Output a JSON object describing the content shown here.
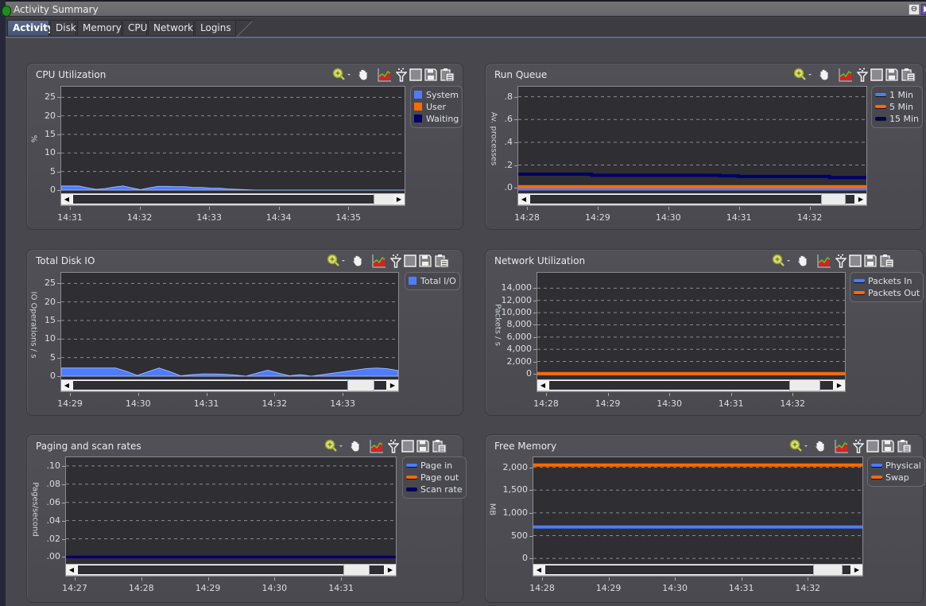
{
  "window": {
    "title": "Activity Summary",
    "controls": [
      "zoom-out",
      "restore"
    ]
  },
  "tabs": [
    {
      "label": "Activity",
      "active": true
    },
    {
      "label": "Disk",
      "active": false
    },
    {
      "label": "Memory",
      "active": false
    },
    {
      "label": "CPU",
      "active": false
    },
    {
      "label": "Network",
      "active": false
    },
    {
      "label": "Logins",
      "active": false
    }
  ],
  "toolbar_icons": [
    "zoom-in-icon",
    "pan-hand-icon",
    "chart-type-icon",
    "filter-icon",
    "maximize-icon",
    "save-icon",
    "clipboard-icon"
  ],
  "colors": {
    "blue": "#4d7cfe",
    "orange": "#ff6a00",
    "navy": "#000066",
    "plot_bg": "#2e2e33"
  },
  "chart_data": [
    {
      "id": "cpu",
      "title": "CPU Utilization",
      "type": "area",
      "ylabel": "%",
      "yticks": [
        "0",
        "5",
        "10",
        "15",
        "20",
        "25"
      ],
      "ylim": [
        0,
        27
      ],
      "xticks": [
        "14:31",
        "14:32",
        "14:33",
        "14:34",
        "14:35"
      ],
      "legend_style": "box",
      "series": [
        {
          "name": "System",
          "color": "#4d7cfe",
          "values": [
            1.1,
            1.1,
            1.1,
            0.6,
            0.2,
            0.4,
            0.8,
            1.1,
            0.6,
            0.1,
            0.6,
            1.0,
            1.0,
            0.9,
            0.9,
            0.7,
            0.7,
            0.5,
            0.5,
            0.3,
            0.2,
            0.1,
            0,
            0,
            0,
            0,
            0,
            0,
            0,
            0,
            0,
            0,
            0,
            0,
            0,
            0,
            0,
            0,
            0,
            0
          ]
        },
        {
          "name": "User",
          "color": "#ff6a00",
          "values": []
        },
        {
          "name": "Waiting",
          "color": "#000066",
          "values": []
        }
      ]
    },
    {
      "id": "runqueue",
      "title": "Run Queue",
      "type": "line",
      "ylabel": "Av. processes",
      "yticks": [
        ".0",
        ".2",
        ".4",
        ".6",
        ".8"
      ],
      "ylim": [
        -0.02,
        0.86
      ],
      "xticks": [
        "14:28",
        "14:29",
        "14:30",
        "14:31",
        "14:32"
      ],
      "legend_style": "line",
      "series": [
        {
          "name": "1 Min",
          "color": "#4d7cfe",
          "values": [
            -0.01,
            -0.01,
            -0.01,
            -0.01,
            -0.01,
            -0.01,
            -0.01,
            -0.01,
            -0.01,
            -0.01,
            -0.01,
            -0.01,
            -0.01,
            -0.01,
            -0.01,
            -0.01,
            -0.01,
            -0.01,
            -0.01,
            -0.01
          ]
        },
        {
          "name": "5 Min",
          "color": "#ff6a00",
          "values": [
            0.01,
            0.01,
            0.01,
            0.01,
            0.01,
            0.01,
            0.01,
            0.01,
            0.01,
            0.01,
            0.01,
            0.01,
            0.01,
            0.01,
            0.01,
            0.01,
            0.01,
            0.01,
            0.01,
            0.01
          ]
        },
        {
          "name": "15 Min",
          "color": "#000066",
          "values": [
            0.12,
            0.12,
            0.12,
            0.12,
            0.11,
            0.11,
            0.11,
            0.11,
            0.11,
            0.11,
            0.11,
            0.105,
            0.1,
            0.1,
            0.1,
            0.1,
            0.1,
            0.09,
            0.09,
            0.09
          ]
        }
      ]
    },
    {
      "id": "diskio",
      "title": "Total Disk IO",
      "type": "area",
      "ylabel": "IO Operations / s",
      "yticks": [
        "0",
        "5",
        "10",
        "15",
        "20",
        "25"
      ],
      "ylim": [
        0,
        27
      ],
      "xticks": [
        "14:29",
        "14:30",
        "14:31",
        "14:32",
        "14:33"
      ],
      "legend_style": "box",
      "series": [
        {
          "name": "Total I/O",
          "color": "#4d7cfe",
          "values": [
            2.2,
            2.2,
            2.2,
            2.2,
            2.2,
            2.2,
            1.3,
            0.2,
            1.2,
            2.2,
            1.2,
            0.1,
            0.4,
            0.6,
            0.6,
            0.5,
            0.3,
            0.0,
            0.8,
            1.6,
            0.8,
            0.1,
            0.4,
            0.0,
            0.4,
            0.8,
            1.2,
            1.6,
            2.0,
            2.2,
            2.0,
            1.5
          ]
        }
      ]
    },
    {
      "id": "network",
      "title": "Network Utilization",
      "type": "line",
      "ylabel": "Packets / s",
      "yticks": [
        "0",
        "2,000",
        "4,000",
        "6,000",
        "8,000",
        "10,000",
        "12,000",
        "14,000"
      ],
      "ylim": [
        -400,
        16000
      ],
      "xticks": [
        "14:28",
        "14:29",
        "14:30",
        "14:31",
        "14:32"
      ],
      "legend_style": "line",
      "series": [
        {
          "name": "Packets In",
          "color": "#4d7cfe",
          "values": [
            0,
            0,
            0,
            0,
            0,
            0,
            0,
            0,
            0,
            0
          ]
        },
        {
          "name": "Packets Out",
          "color": "#ff6a00",
          "values": [
            0,
            0,
            0,
            0,
            0,
            0,
            0,
            0,
            0,
            0
          ]
        }
      ]
    },
    {
      "id": "paging",
      "title": "Paging and scan rates",
      "type": "line",
      "ylabel": "Pages/second",
      "yticks": [
        ".00",
        ".02",
        ".04",
        ".06",
        ".08",
        ".10"
      ],
      "ylim": [
        -0.004,
        0.106
      ],
      "xticks": [
        "14:27",
        "14:28",
        "14:29",
        "14:30",
        "14:31"
      ],
      "legend_style": "line",
      "series": [
        {
          "name": "Page in",
          "color": "#4d7cfe",
          "values": [
            0,
            0,
            0,
            0,
            0,
            0,
            0,
            0,
            0,
            0
          ]
        },
        {
          "name": "Page out",
          "color": "#ff6a00",
          "values": [
            0,
            0,
            0,
            0,
            0,
            0,
            0,
            0,
            0,
            0
          ]
        },
        {
          "name": "Scan rate",
          "color": "#000066",
          "values": [
            0,
            0,
            0,
            0,
            0,
            0,
            0,
            0,
            0,
            0
          ]
        }
      ]
    },
    {
      "id": "memory",
      "title": "Free Memory",
      "type": "line",
      "ylabel": "MB",
      "yticks": [
        "0",
        "500",
        "1,000",
        "1,500",
        "2,000"
      ],
      "ylim": [
        -50,
        2150
      ],
      "xticks": [
        "14:28",
        "14:29",
        "14:30",
        "14:31",
        "14:32"
      ],
      "legend_style": "line",
      "series": [
        {
          "name": "Physical",
          "color": "#4d7cfe",
          "values": [
            690,
            690,
            690,
            690,
            690,
            690,
            690,
            690,
            690,
            690
          ]
        },
        {
          "name": "Swap",
          "color": "#ff6a00",
          "values": [
            2050,
            2050,
            2050,
            2050,
            2050,
            2050,
            2050,
            2050,
            2050,
            2050
          ]
        }
      ]
    }
  ]
}
